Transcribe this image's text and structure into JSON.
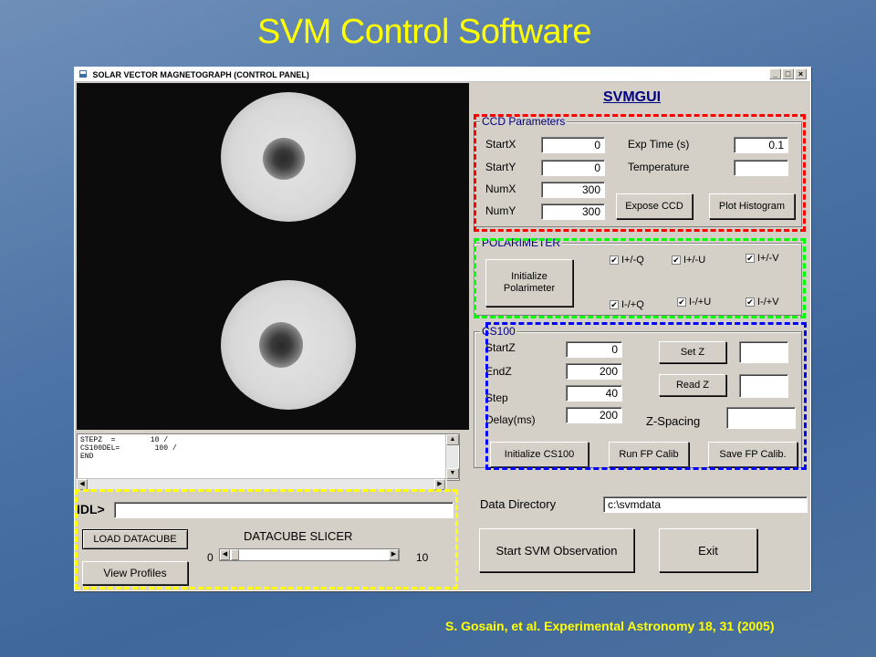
{
  "slide": {
    "title": "SVM  Control Software",
    "citation": "S. Gosain, et al.  Experimental Astronomy 18, 31 (2005)"
  },
  "window": {
    "title": "SOLAR VECTOR MAGNETOGRAPH (CONTROL PANEL)",
    "minimize": "_",
    "maximize": "□",
    "close": "×",
    "app_heading": "SVMGUI"
  },
  "log": {
    "text": "STEPZ  =        10 /\nCS100DEL=        100 /\nEND"
  },
  "ccd": {
    "label": "CCD Parameters",
    "startx_label": "StartX",
    "startx_value": "0",
    "starty_label": "StartY",
    "starty_value": "0",
    "numx_label": "NumX",
    "numx_value": "300",
    "numy_label": "NumY",
    "numy_value": "300",
    "exp_label": "Exp Time (s)",
    "exp_value": "0.1",
    "temp_label": "Temperature",
    "temp_value": "",
    "expose_button": "Expose CCD",
    "histogram_button": "Plot Histogram"
  },
  "polarimeter": {
    "label": "POLARIMETER",
    "init_button": "Initialize\nPolarimeter",
    "checks": [
      "I+/-Q",
      "I+/-U",
      "I+/-V",
      "I-/+Q",
      "I-/+U",
      "I-/+V"
    ],
    "check_mark": "✔"
  },
  "cs100": {
    "label": "CS100",
    "startz_label": "StartZ",
    "startz_value": "0",
    "endz_label": "EndZ",
    "endz_value": "200",
    "step_label": "Step",
    "step_value": "40",
    "delay_label": "Delay(ms)",
    "delay_value": "200",
    "setz_button": "Set Z",
    "readz_button": "Read Z",
    "zspacing_label": "Z-Spacing",
    "init_button": "Initialize CS100",
    "calib_button": "Run FP Calib",
    "save_button": "Save FP Calib."
  },
  "idl": {
    "prompt": "IDL>",
    "value": "",
    "load_button": "LOAD DATACUBE",
    "profiles_button": "View Profiles",
    "slicer_label": "DATACUBE SLICER",
    "slicer_min": "0",
    "slicer_max": "10",
    "slicer_value": 0
  },
  "bottom": {
    "dir_label": "Data Directory",
    "dir_value": "c:\\svmdata",
    "start_button": "Start SVM Observation",
    "exit_button": "Exit"
  },
  "colors": {
    "ccd_outline": "#ff0000",
    "polarimeter_outline": "#00ff00",
    "cs100_outline": "#0000ff",
    "idl_outline": "#ffff00"
  }
}
